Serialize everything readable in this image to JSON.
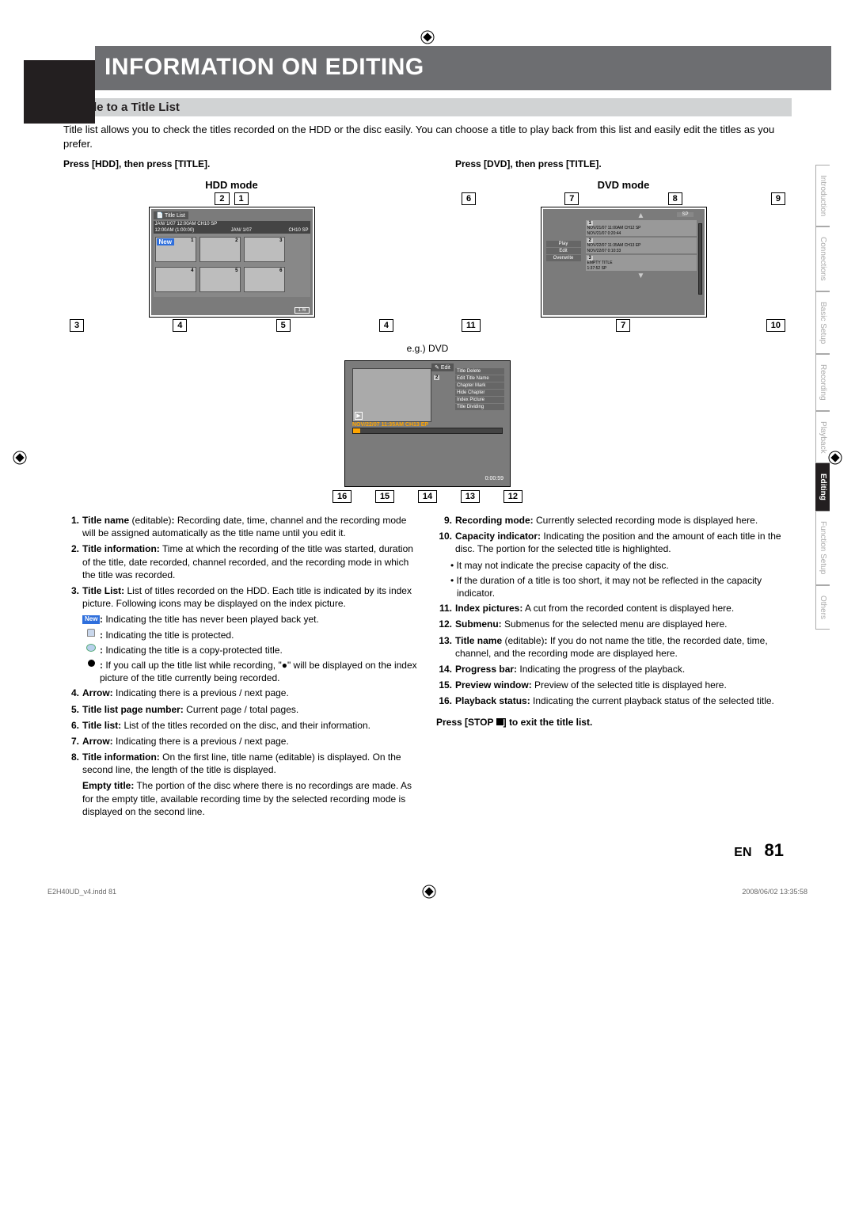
{
  "page": {
    "title": "INFORMATION ON EDITING",
    "section_header": "Guide to a Title List",
    "intro": "Title list allows you to check the titles recorded on the HDD or the disc easily. You can choose a title to play back from this list and easily edit the titles as you prefer.",
    "page_lang": "EN",
    "page_num": "81",
    "footer_left": "E2H40UD_v4.indd   81",
    "footer_right": "2008/06/02   13:35:58"
  },
  "side_tabs": [
    "Introduction",
    "Connections",
    "Basic Setup",
    "Recording",
    "Playback",
    "Editing",
    "Function Setup",
    "Others"
  ],
  "side_tab_active": "Editing",
  "hdd": {
    "press": "Press [HDD], then press [TITLE].",
    "mode": "HDD mode",
    "callouts_top": [
      "2",
      "1"
    ],
    "callouts_bottom": [
      "3",
      "4",
      "5",
      "4"
    ],
    "screen": {
      "title": "Title List",
      "line1": "JAN/ 1/07 12:00AM  CH10  SP",
      "line2a": "12:00AM (1:00:00)",
      "line2b": "JAN/ 1/07",
      "line2c": "CH10 SP",
      "page_count": "1 /6",
      "badge_new": "New",
      "thumbs": [
        "1",
        "2",
        "3",
        "4",
        "5",
        "6"
      ]
    }
  },
  "dvd": {
    "press": "Press [DVD], then press [TITLE].",
    "mode": "DVD mode",
    "callouts_top": [
      "6",
      "7",
      "8",
      "9"
    ],
    "callouts_bottom": [
      "11",
      "7",
      "10"
    ],
    "screen": {
      "sp_label": "SP",
      "r1a": "NOV/21/07  11:00AM CH12 SP",
      "r1b": "NOV/21/07   0:20:44",
      "r2a": "NOV/22/07  11:35AM CH13 EP",
      "r2b": "NOV/22/07   0:10:33",
      "empty_a": "EMPTY TITLE",
      "empty_b": "1:37:52   SP",
      "menu": [
        "Play",
        "Edit",
        "Overwrite"
      ],
      "nums": [
        "1",
        "2",
        "3"
      ]
    }
  },
  "edit": {
    "label": "e.g.) DVD",
    "callouts": [
      "16",
      "15",
      "14",
      "13",
      "12"
    ],
    "hdr": "Edit",
    "idx": "2",
    "submenu": [
      "Title Delete",
      "Edit Title Name",
      "Chapter Mark",
      "Hide Chapter",
      "Index Picture",
      "Title Dividing"
    ],
    "info": "NOV/22/07 11:35AM CH13 EP",
    "time": "0:00:59"
  },
  "list_left": [
    {
      "n": "1.",
      "term": "Title name",
      "paren": " (editable)",
      "colon": ":",
      "body": " Recording date, time, channel and the recording mode will be assigned automatically as the title name until you edit it."
    },
    {
      "n": "2.",
      "term": "Title information:",
      "body": " Time at which the recording of the title was started, duration of the title, date recorded, channel recorded, and the recording mode in which the title was recorded."
    },
    {
      "n": "3.",
      "term": "Title List:",
      "body": " List of titles recorded on the HDD. Each title is indicated by its index picture. Following icons may be displayed on the index picture."
    }
  ],
  "list_left_icons": [
    {
      "icon": "new",
      "text": ": Indicating the title has never been played back yet."
    },
    {
      "icon": "lock",
      "text": ": Indicating the title is protected."
    },
    {
      "icon": "copy",
      "text": ": Indicating the title is a copy-protected title."
    },
    {
      "icon": "rec",
      "text": ": If you call up the title list while recording, \"●\" will be displayed on the index picture of the title currently being recorded."
    }
  ],
  "list_left_rest": [
    {
      "n": "4.",
      "term": "Arrow:",
      "body": " Indicating there is a previous / next page."
    },
    {
      "n": "5.",
      "term": "Title list page number:",
      "body": " Current page / total pages."
    },
    {
      "n": "6.",
      "term": "Title list:",
      "body": " List of the titles recorded on the disc, and their information."
    },
    {
      "n": "7.",
      "term": "Arrow:",
      "body": " Indicating there is a previous / next page."
    },
    {
      "n": "8.",
      "term": "Title information:",
      "body": " On the first line, title name (editable) is displayed. On the second line, the length of the title is displayed."
    }
  ],
  "empty_title_term": "Empty title:",
  "empty_title_body": " The portion of the disc where there is no recordings are made. As for the empty title, available recording time by the selected recording mode is displayed on the second line.",
  "list_right": [
    {
      "n": "9.",
      "term": "Recording mode:",
      "body": " Currently selected recording mode is displayed here."
    },
    {
      "n": "10.",
      "term": "Capacity indicator:",
      "body": " Indicating the position and the amount of each title in the disc. The portion for the selected title is highlighted."
    }
  ],
  "list_right_bullets": [
    "It may not indicate the precise capacity of the disc.",
    "If the duration of a title is too short, it may not be reflected in the capacity indicator."
  ],
  "list_right_rest": [
    {
      "n": "11.",
      "term": "Index pictures:",
      "body": " A cut from the recorded content is displayed here."
    },
    {
      "n": "12.",
      "term": "Submenu:",
      "body": " Submenus for the selected menu are displayed here."
    },
    {
      "n": "13.",
      "term": "Title name",
      "paren": " (editable)",
      "colon": ":",
      "body": " If you do not name the title, the recorded date, time, channel, and the recording mode are displayed here."
    },
    {
      "n": "14.",
      "term": "Progress bar:",
      "body": " Indicating the progress of the playback."
    },
    {
      "n": "15.",
      "term": "Preview window:",
      "body": " Preview of the selected title is displayed here."
    },
    {
      "n": "16.",
      "term": "Playback status:",
      "body": " Indicating the current playback status of the selected title."
    }
  ],
  "exit_line_a": "Press [STOP ",
  "exit_line_b": "] to exit the title list."
}
